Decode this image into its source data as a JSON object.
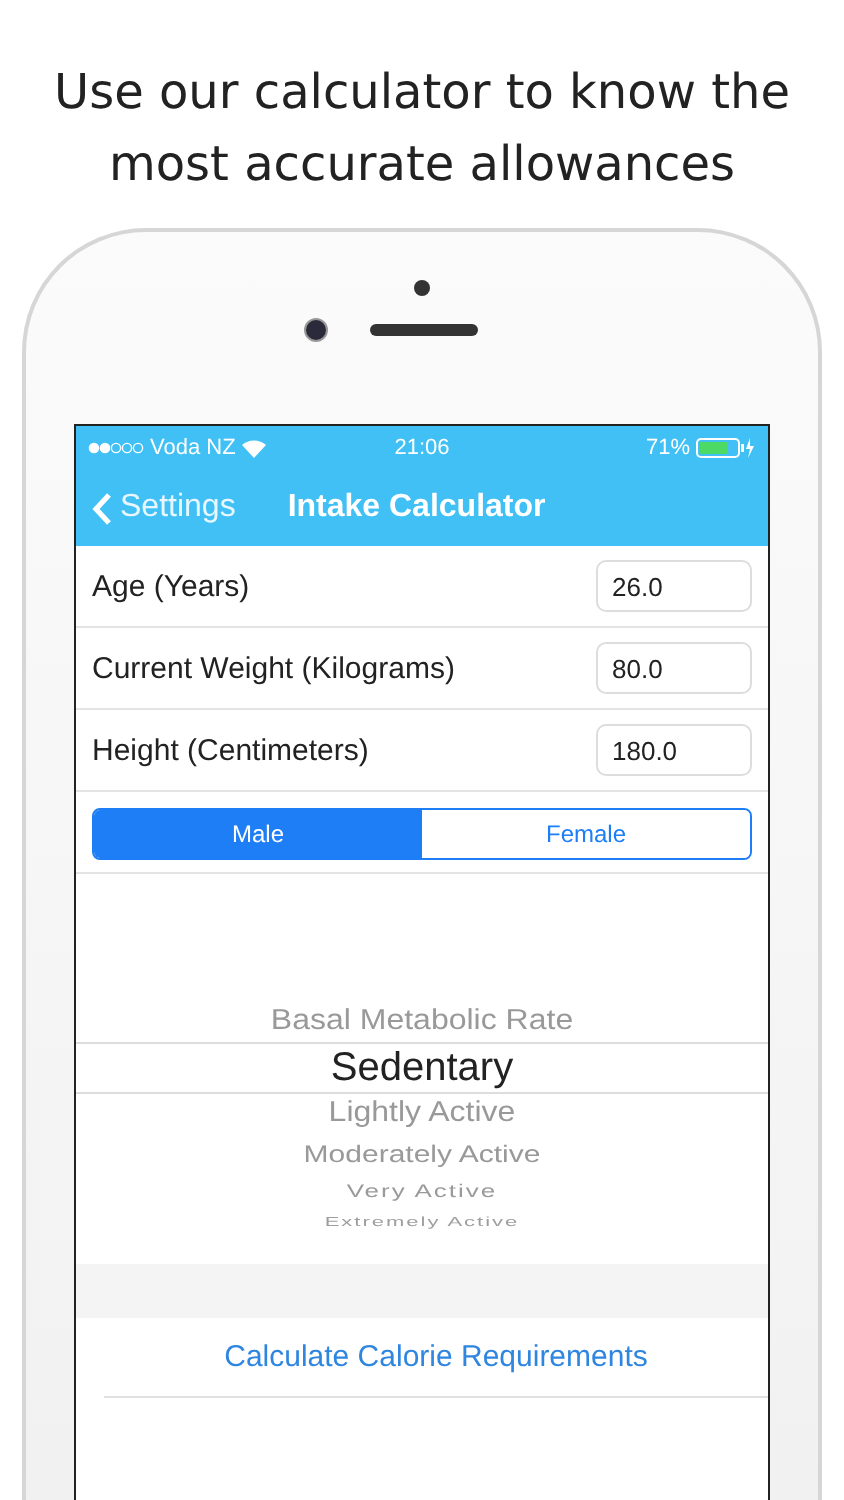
{
  "headline": "Use our calculator to know the most accurate allowances",
  "status_bar": {
    "carrier": "Voda NZ",
    "time": "21:06",
    "battery": "71%"
  },
  "nav": {
    "back": "Settings",
    "title": "Intake Calculator"
  },
  "fields": [
    {
      "label": "Age (Years)",
      "value": "26.0"
    },
    {
      "label": "Current Weight (Kilograms)",
      "value": "80.0"
    },
    {
      "label": "Height (Centimeters)",
      "value": "180.0"
    }
  ],
  "gender": [
    {
      "label": "Male",
      "selected": true
    },
    {
      "label": "Female",
      "selected": false
    }
  ],
  "activity_picker": [
    {
      "label": "Basal Metabolic Rate",
      "selected": false
    },
    {
      "label": "Sedentary",
      "selected": true
    },
    {
      "label": "Lightly Active",
      "selected": false
    },
    {
      "label": "Moderately Active",
      "selected": false
    },
    {
      "label": "Very Active",
      "selected": false
    },
    {
      "label": "Extremely Active",
      "selected": false
    }
  ],
  "action": "Calculate Calorie Requirements"
}
